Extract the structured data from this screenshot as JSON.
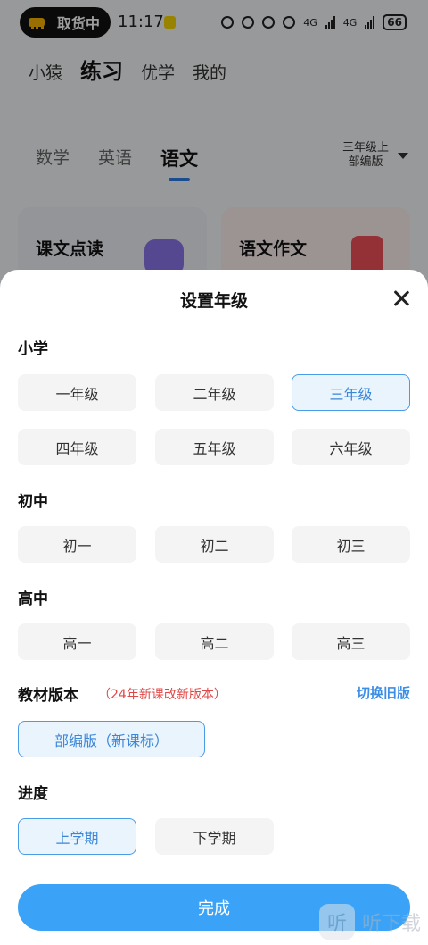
{
  "status_bar": {
    "pill_text": "取货中",
    "time": "11:17",
    "network_1": "4G",
    "network_2": "4G",
    "battery": "66"
  },
  "top_nav": {
    "items": [
      "小猿",
      "练习",
      "优学",
      "我的"
    ],
    "active": "练习"
  },
  "subject_tabs": {
    "items": [
      "数学",
      "英语",
      "语文"
    ],
    "active": "语文"
  },
  "grade_selector": {
    "line1": "三年级上",
    "line2": "部编版"
  },
  "cards": [
    {
      "title": "课文点读",
      "subtitle": ""
    },
    {
      "title": "语文作文",
      "subtitle": ""
    }
  ],
  "sheet": {
    "title": "设置年级",
    "sections": {
      "primary": {
        "label": "小学",
        "options": [
          "一年级",
          "二年级",
          "三年级",
          "四年级",
          "五年级",
          "六年级"
        ],
        "selected": "三年级"
      },
      "junior": {
        "label": "初中",
        "options": [
          "初一",
          "初二",
          "初三"
        ]
      },
      "senior": {
        "label": "高中",
        "options": [
          "高一",
          "高二",
          "高三"
        ]
      },
      "textbook": {
        "label": "教材版本",
        "note": "（24年新课改新版本）",
        "switch_label": "切换旧版",
        "option": "部编版（新课标）"
      },
      "progress": {
        "label": "进度",
        "options": [
          "上学期",
          "下学期"
        ],
        "selected": "上学期"
      }
    },
    "done_label": "完成"
  },
  "watermark": {
    "logo_char": "听",
    "text": "听下载"
  },
  "colors": {
    "accent": "#3aa3f7",
    "selected_border": "#4a9be8",
    "note_red": "#e04848"
  }
}
